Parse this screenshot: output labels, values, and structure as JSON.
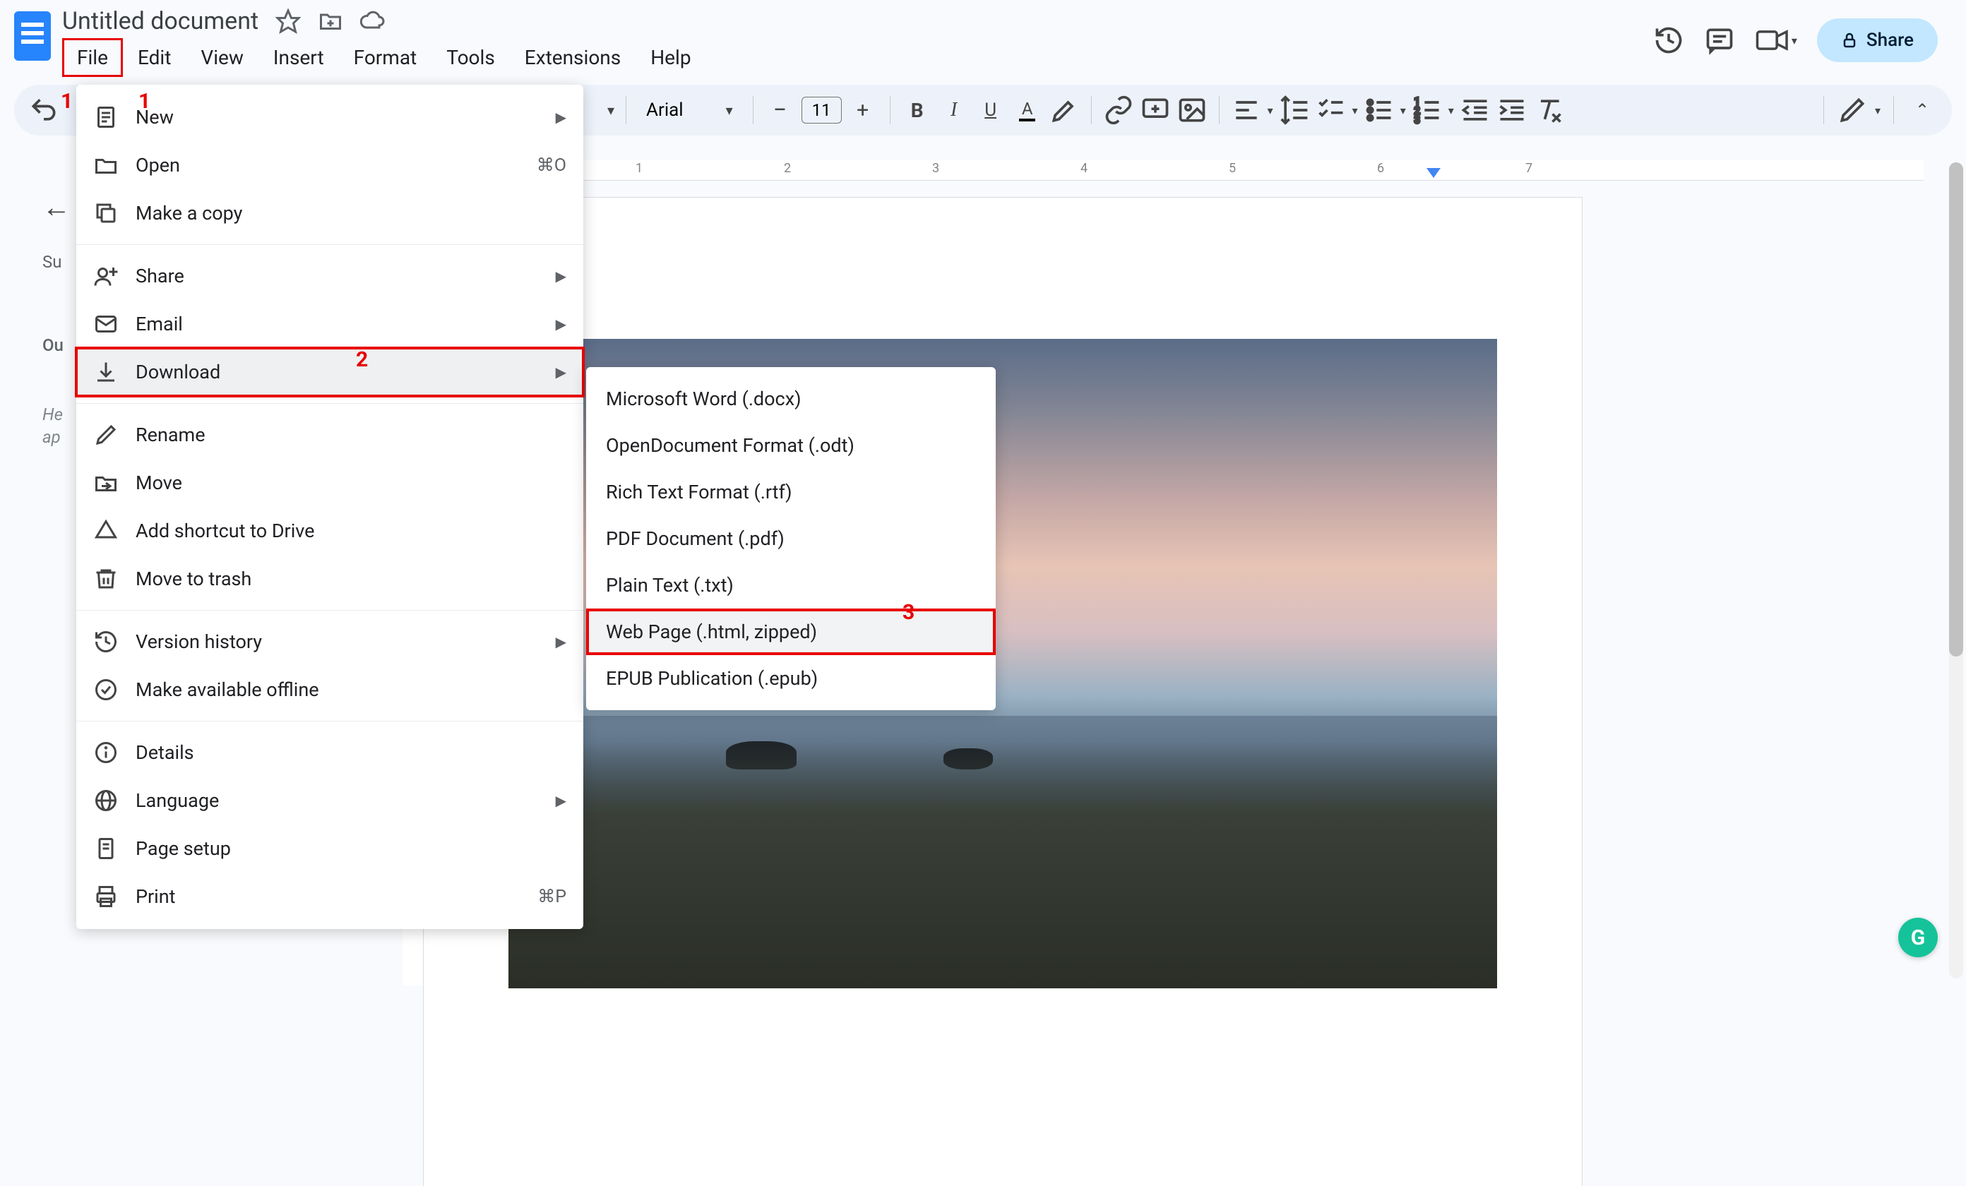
{
  "doc_title": "Untitled document",
  "menubar": [
    "File",
    "Edit",
    "View",
    "Insert",
    "Format",
    "Tools",
    "Extensions",
    "Help"
  ],
  "share_label": "Share",
  "toolbar": {
    "font_name": "Arial",
    "font_size": "11"
  },
  "sidebar": {
    "summary_label": "Su",
    "outline_label": "Ou",
    "headings_placeholder_1": "He",
    "headings_placeholder_2": "ap"
  },
  "file_menu": {
    "new": "New",
    "open": "Open",
    "open_shortcut": "⌘O",
    "make_copy": "Make a copy",
    "share": "Share",
    "email": "Email",
    "download": "Download",
    "rename": "Rename",
    "move": "Move",
    "add_shortcut": "Add shortcut to Drive",
    "move_to_trash": "Move to trash",
    "version_history": "Version history",
    "make_offline": "Make available offline",
    "details": "Details",
    "language": "Language",
    "page_setup": "Page setup",
    "print": "Print",
    "print_shortcut": "⌘P"
  },
  "download_submenu": [
    "Microsoft Word (.docx)",
    "OpenDocument Format (.odt)",
    "Rich Text Format (.rtf)",
    "PDF Document (.pdf)",
    "Plain Text (.txt)",
    "Web Page (.html, zipped)",
    "EPUB Publication (.epub)"
  ],
  "ruler_marks": [
    "1",
    "2",
    "3",
    "4",
    "5",
    "6",
    "7"
  ],
  "annotations": {
    "one_left": "1",
    "one_right": "1",
    "two": "2",
    "three": "3"
  },
  "grammarly_letter": "G"
}
